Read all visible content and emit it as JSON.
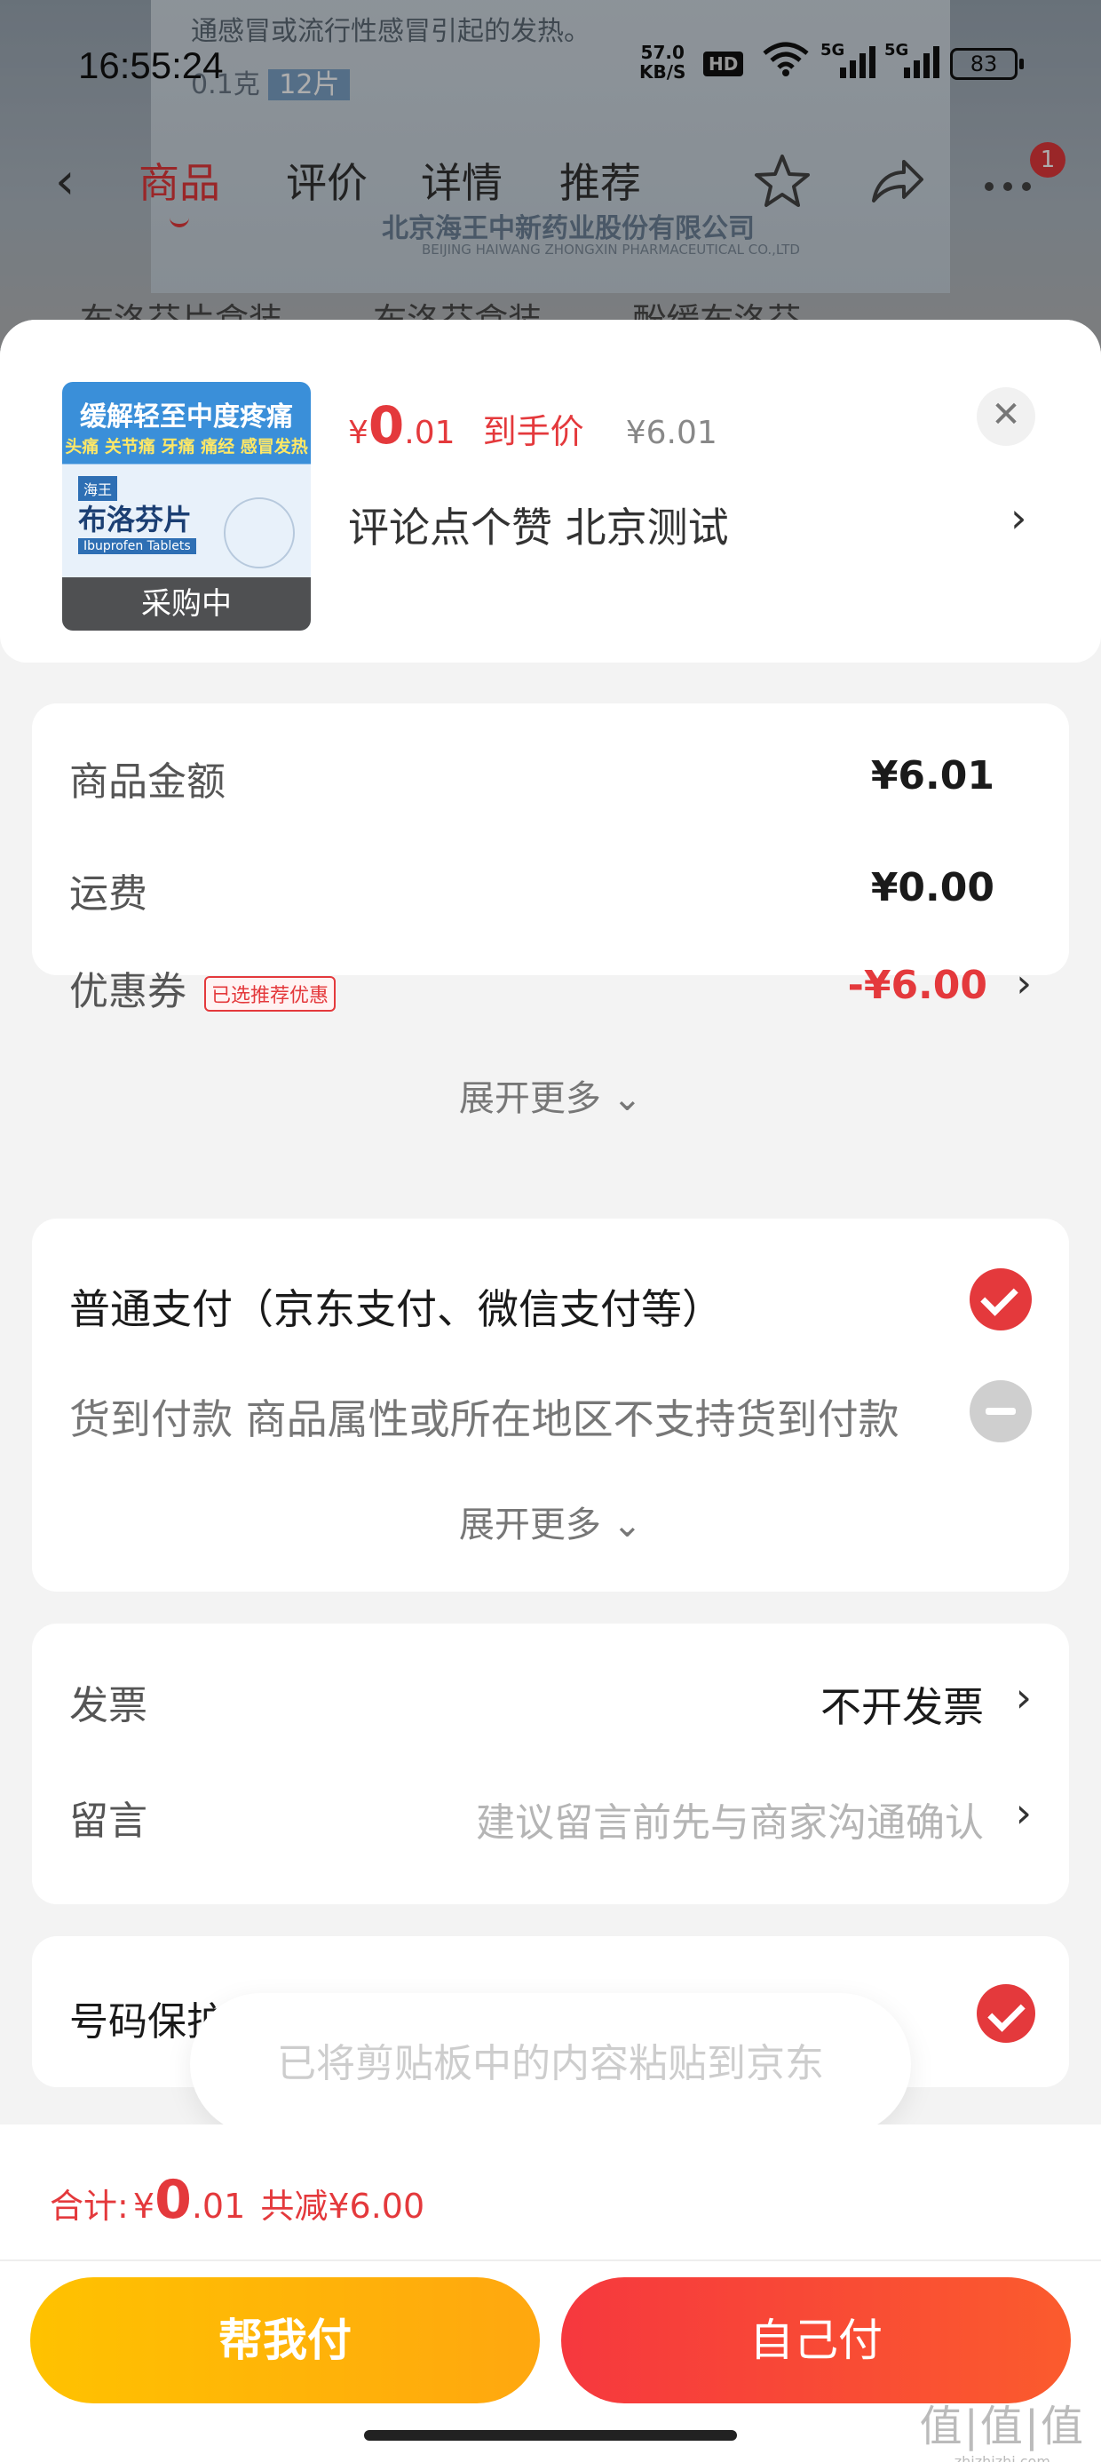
{
  "status_bar": {
    "time": "16:55:24",
    "net_speed": "57.0",
    "net_unit": "KB/S",
    "hd": "HD",
    "sim1": "5G",
    "sim2": "5G",
    "battery": "83"
  },
  "background": {
    "box_line": "通感冒或流行性感冒引起的发热。",
    "box_spec": "0.1克",
    "box_count": "12片",
    "maker": "北京海王中新药业股份有限公司",
    "maker_en": "BEIJING HAIWANG ZHONGXIN PHARMACEUTICAL CO.,LTD",
    "search_chips": [
      "布洛芬片盒装",
      "布洛芬盒装",
      "酚缓布洛芬"
    ]
  },
  "nav": {
    "back_icon": "chevron-left-icon",
    "tabs": [
      "商品",
      "评价",
      "详情",
      "推荐"
    ],
    "active_tab": 0,
    "badge": "1"
  },
  "product": {
    "thumb_title": "缓解轻至中度疼痛",
    "thumb_sub": "头痛 关节痛 牙痛 痛经 感冒发热",
    "thumb_brand": "海王",
    "thumb_name": "布洛芬片",
    "thumb_en": "Ibuprofen Tablets",
    "status_tag": "采购中",
    "price_currency": "¥",
    "price_int": "0",
    "price_dec": ".01",
    "price_tag": "到手价",
    "orig_price": "¥6.01",
    "spec": "评论点个赞  北京测试",
    "close_icon": "close-icon"
  },
  "amounts": {
    "goods_label": "商品金额",
    "goods_value": "¥6.01",
    "ship_label": "运费",
    "ship_value": "¥0.00",
    "coupon_label": "优惠券",
    "coupon_badge": "已选推荐优惠",
    "coupon_value": "-¥6.00",
    "expand": "展开更多"
  },
  "payment": {
    "normal": "普通支付（京东支付、微信支付等）",
    "cod": "货到付款 商品属性或所在地区不支持货到付款",
    "expand": "展开更多",
    "normal_selected": true
  },
  "extras": {
    "invoice_label": "发票",
    "invoice_value": "不开发票",
    "message_label": "留言",
    "message_placeholder": "建议留言前先与商家沟通确认"
  },
  "privacy": {
    "label": "号码保护"
  },
  "toast": "已将剪贴板中的内容粘贴到京东",
  "footer": {
    "total_label": "合计:",
    "currency": "¥",
    "total_int": "0",
    "total_dec": ".01",
    "saved": "共减¥6.00",
    "help_pay": "帮我付",
    "self_pay": "自己付"
  },
  "watermark": {
    "text": "值|值|值",
    "site": "zhizhizhi.com"
  },
  "colors": {
    "accent": "#e4393c",
    "help_btn": "#ffb300",
    "self_btn": "#f6383e"
  }
}
